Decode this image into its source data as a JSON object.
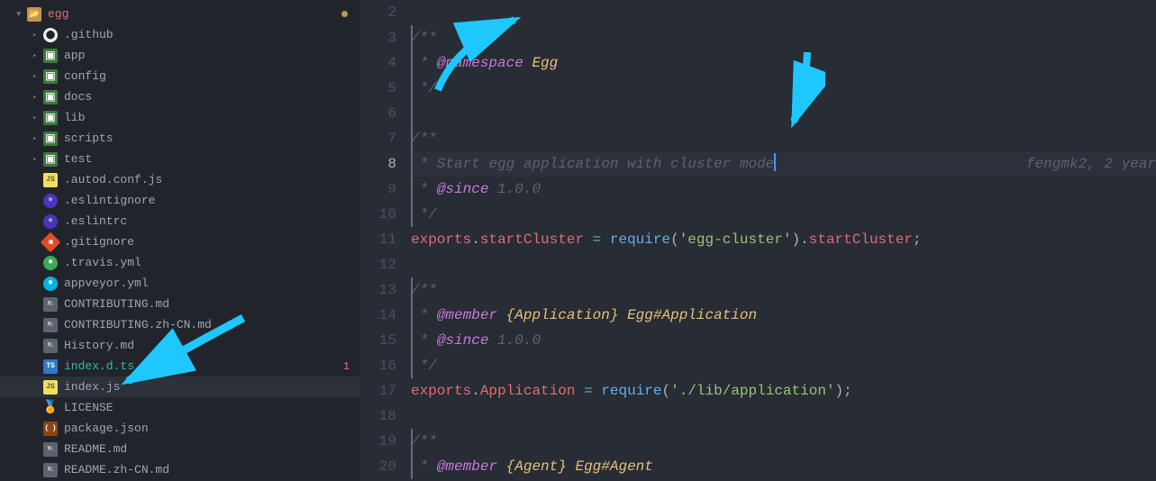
{
  "sidebar": {
    "root": "egg",
    "items": [
      {
        "label": ".github",
        "icon": "github"
      },
      {
        "label": "app",
        "icon": "pkg"
      },
      {
        "label": "config",
        "icon": "pkg"
      },
      {
        "label": "docs",
        "icon": "pkg"
      },
      {
        "label": "lib",
        "icon": "pkg"
      },
      {
        "label": "scripts",
        "icon": "pkg"
      },
      {
        "label": "test",
        "icon": "pkg"
      },
      {
        "label": ".autod.conf.js",
        "icon": "js"
      },
      {
        "label": ".eslintignore",
        "icon": "eslint"
      },
      {
        "label": ".eslintrc",
        "icon": "eslint"
      },
      {
        "label": ".gitignore",
        "icon": "gitignore"
      },
      {
        "label": ".travis.yml",
        "icon": "travis"
      },
      {
        "label": "appveyor.yml",
        "icon": "appveyor"
      },
      {
        "label": "CONTRIBUTING.md",
        "icon": "md"
      },
      {
        "label": "CONTRIBUTING.zh-CN.md",
        "icon": "md"
      },
      {
        "label": "History.md",
        "icon": "md"
      },
      {
        "label": "index.d.ts",
        "icon": "ts",
        "teal": true,
        "badge": "1"
      },
      {
        "label": "index.js",
        "icon": "js",
        "selected": true
      },
      {
        "label": "LICENSE",
        "icon": "license"
      },
      {
        "label": "package.json",
        "icon": "json"
      },
      {
        "label": "README.md",
        "icon": "md"
      },
      {
        "label": "README.zh-CN.md",
        "icon": "md"
      }
    ]
  },
  "editor": {
    "lines": [
      2,
      3,
      4,
      5,
      6,
      7,
      8,
      9,
      10,
      11,
      12,
      13,
      14,
      15,
      16,
      17,
      18,
      19,
      20
    ],
    "cursor_line": 8,
    "blame": "fengmk2, 2 year",
    "tokens": {
      "ns": "@namespace",
      "egg": "Egg",
      "l8": " * Start egg application with cluster mode",
      "since": "@since",
      "ver": "1.0.0",
      "exports": "exports",
      "startCluster": "startCluster",
      "require": "require",
      "eggcluster": "'egg-cluster'",
      "member": "@member",
      "AppType": "{Application}",
      "EggApp": "Egg#Application",
      "Application": "Application",
      "libapp": "'./lib/application'",
      "AgentType": "{Agent}",
      "EggAgent": "Egg#Agent"
    }
  }
}
